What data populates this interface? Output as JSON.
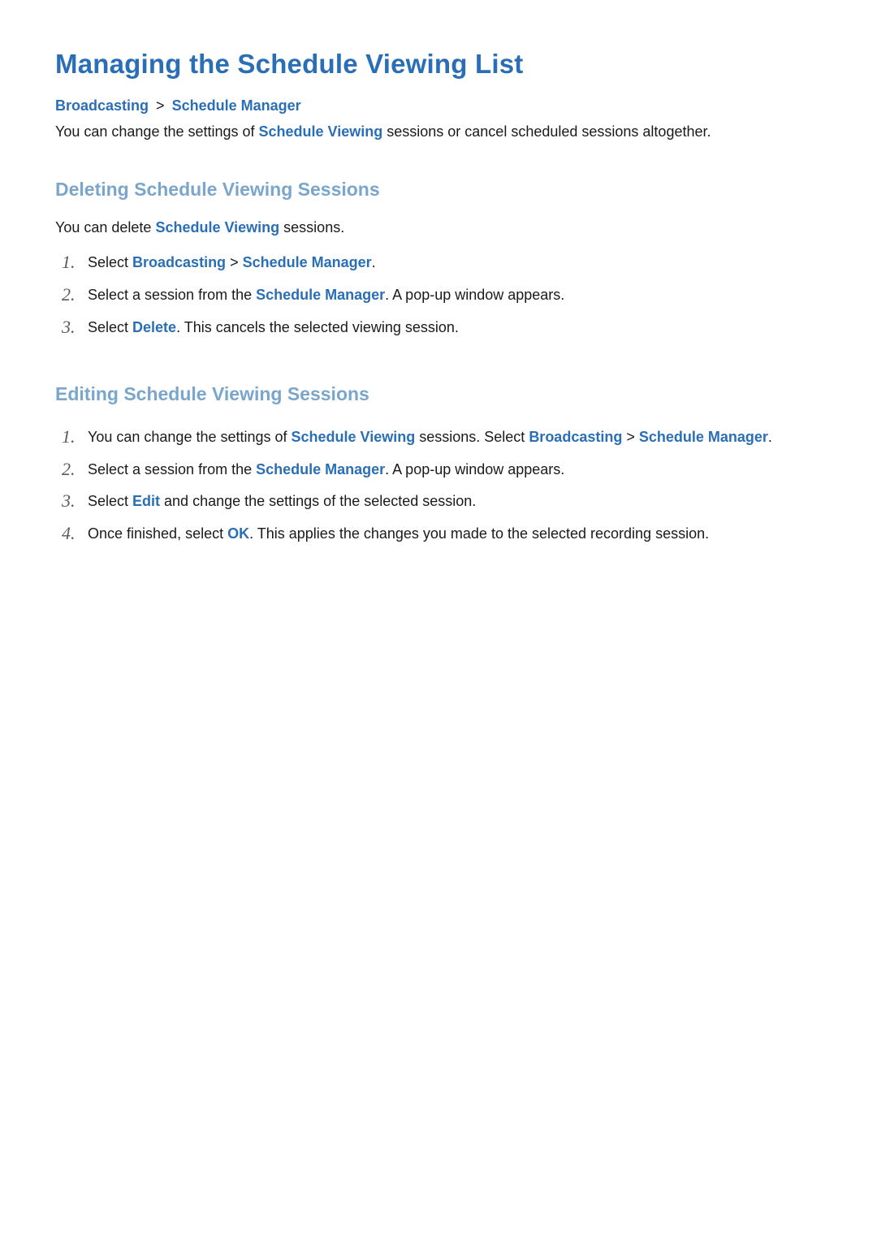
{
  "title": "Managing the Schedule Viewing List",
  "breadcrumb": {
    "a": "Broadcasting",
    "sep": ">",
    "b": "Schedule Manager"
  },
  "intro": {
    "pre": "You can change the settings of ",
    "hl": "Schedule Viewing",
    "post": " sessions or cancel scheduled sessions altogether."
  },
  "section1": {
    "heading": "Deleting Schedule Viewing Sessions",
    "intro": {
      "pre": "You can delete ",
      "hl": "Schedule Viewing",
      "post": " sessions."
    },
    "steps": [
      {
        "runs": [
          {
            "t": "Select "
          },
          {
            "t": "Broadcasting",
            "hl": true
          },
          {
            "t": " > "
          },
          {
            "t": "Schedule Manager",
            "hl": true
          },
          {
            "t": "."
          }
        ]
      },
      {
        "runs": [
          {
            "t": "Select a session from the "
          },
          {
            "t": "Schedule Manager",
            "hl": true
          },
          {
            "t": ". A pop-up window appears."
          }
        ]
      },
      {
        "runs": [
          {
            "t": "Select "
          },
          {
            "t": "Delete",
            "hl": true
          },
          {
            "t": ". This cancels the selected viewing session."
          }
        ]
      }
    ]
  },
  "section2": {
    "heading": "Editing Schedule Viewing Sessions",
    "steps": [
      {
        "runs": [
          {
            "t": "You can change the settings of "
          },
          {
            "t": "Schedule Viewing",
            "hl": true
          },
          {
            "t": " sessions. Select "
          },
          {
            "t": "Broadcasting",
            "hl": true
          },
          {
            "t": " > "
          },
          {
            "t": "Schedule Manager",
            "hl": true
          },
          {
            "t": "."
          }
        ]
      },
      {
        "runs": [
          {
            "t": "Select a session from the "
          },
          {
            "t": "Schedule Manager",
            "hl": true
          },
          {
            "t": ". A pop-up window appears."
          }
        ]
      },
      {
        "runs": [
          {
            "t": "Select "
          },
          {
            "t": "Edit",
            "hl": true
          },
          {
            "t": " and change the settings of the selected session."
          }
        ]
      },
      {
        "runs": [
          {
            "t": "Once finished, select "
          },
          {
            "t": "OK",
            "hl": true
          },
          {
            "t": ". This applies the changes you made to the selected recording session."
          }
        ]
      }
    ]
  }
}
